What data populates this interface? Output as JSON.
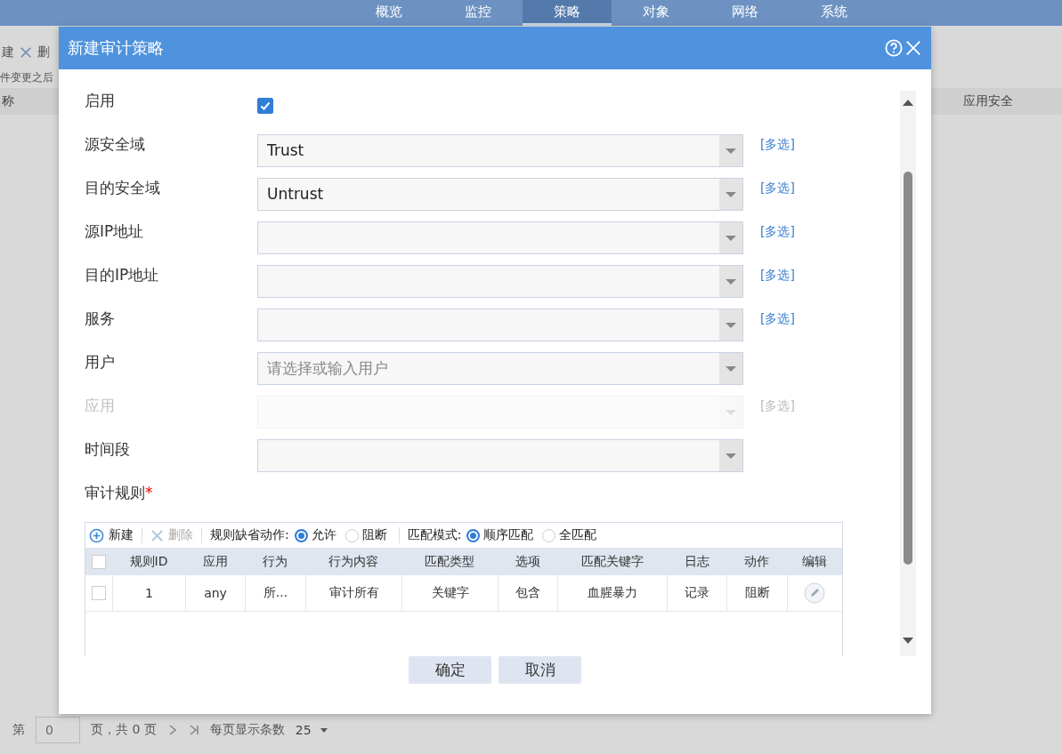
{
  "background": {
    "nav_tabs": [
      {
        "label": "概览",
        "selected": false
      },
      {
        "label": "监控",
        "selected": false
      },
      {
        "label": "策略",
        "selected": true
      },
      {
        "label": "对象",
        "selected": false
      },
      {
        "label": "网络",
        "selected": false
      },
      {
        "label": "系统",
        "selected": false
      }
    ],
    "toolbar": [
      "建",
      "删"
    ],
    "notice": "件变更之后",
    "column_1": "称",
    "column_2": "应用安全",
    "pagination": {
      "page_prefix": "第",
      "page_value": "0",
      "page_suffix": "页，共 0 页",
      "per_page_label": "每页显示条数",
      "per_page": "25"
    }
  },
  "dialog": {
    "title": "新建审计策略",
    "form": [
      {
        "label": "启用",
        "kind": "checkbox",
        "checked": true
      },
      {
        "label": "源安全域",
        "kind": "select",
        "value": "Trust",
        "multi": "[多选]",
        "disabled": false
      },
      {
        "label": "目的安全域",
        "kind": "select",
        "value": "Untrust",
        "multi": "[多选]",
        "disabled": false
      },
      {
        "label": "源IP地址",
        "kind": "select",
        "multi": "[多选]",
        "disabled": false
      },
      {
        "label": "目的IP地址",
        "kind": "select",
        "multi": "[多选]",
        "disabled": false
      },
      {
        "label": "服务",
        "kind": "select",
        "multi": "[多选]",
        "disabled": false
      },
      {
        "label": "用户",
        "kind": "select",
        "placeholder": "请选择或输入用户",
        "disabled": false
      },
      {
        "label": "应用",
        "kind": "select",
        "multi": "[多选]",
        "disabled": true
      },
      {
        "label": "时间段",
        "kind": "select",
        "disabled": false
      }
    ],
    "rules_label": "审计规则",
    "required_mark": "*",
    "rules": {
      "toolbar": [
        {
          "label": "新建",
          "kind": "add",
          "disabled": false
        },
        {
          "label": "删除",
          "kind": "delete",
          "disabled": true
        }
      ],
      "select_all_checked": false,
      "default_action_label": "规则缺省动作:",
      "default_actions": [
        {
          "label": "允许",
          "selected": true
        },
        {
          "label": "阻断",
          "selected": false
        }
      ],
      "match_mode_label": "匹配模式:",
      "match_modes": [
        {
          "label": "顺序匹配",
          "selected": true
        },
        {
          "label": "全匹配",
          "selected": false
        }
      ],
      "columns": [
        "规则ID",
        "应用",
        "行为",
        "行为内容",
        "匹配类型",
        "选项",
        "匹配关键字",
        "日志",
        "动作",
        "编辑"
      ],
      "rows": [
        {
          "selected": false,
          "cells": [
            "1",
            "any",
            "所...",
            "审计所有",
            "关键字",
            "包含",
            "血腥暴力",
            "记录",
            "阻断"
          ]
        }
      ]
    },
    "buttons": [
      "确定",
      "取消"
    ]
  }
}
